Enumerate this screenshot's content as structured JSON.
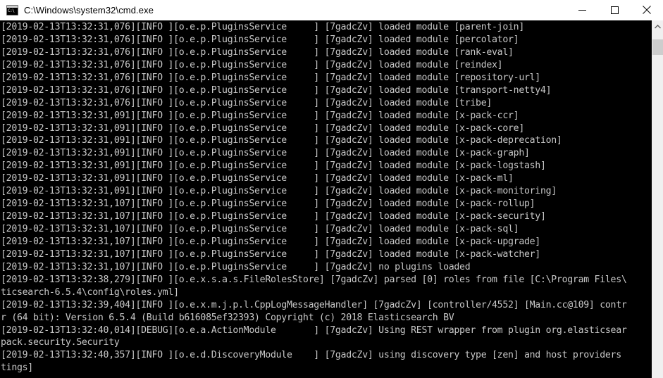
{
  "window": {
    "title": "C:\\Windows\\system32\\cmd.exe",
    "icon": "cmd-console-icon",
    "icon_text": "C:\\",
    "controls": {
      "minimize": "minimize-button",
      "maximize": "maximize-button",
      "close": "close-button"
    },
    "colors": {
      "titlebar_bg": "#ffffff",
      "title_fg": "#000000",
      "console_bg": "#000000",
      "console_fg": "#c8c8c8",
      "scrollbar_track": "#f0f0f0",
      "scrollbar_thumb": "#cdcdcd"
    }
  },
  "scrollbar": {
    "up_arrow": "scroll-up-arrow-icon",
    "thumb_position_percent": 2
  },
  "console": {
    "lines": [
      "[2019-02-13T13:32:31,076][INFO ][o.e.p.PluginsService     ] [7gadcZv] loaded module [parent-join]",
      "[2019-02-13T13:32:31,076][INFO ][o.e.p.PluginsService     ] [7gadcZv] loaded module [percolator]",
      "[2019-02-13T13:32:31,076][INFO ][o.e.p.PluginsService     ] [7gadcZv] loaded module [rank-eval]",
      "[2019-02-13T13:32:31,076][INFO ][o.e.p.PluginsService     ] [7gadcZv] loaded module [reindex]",
      "[2019-02-13T13:32:31,076][INFO ][o.e.p.PluginsService     ] [7gadcZv] loaded module [repository-url]",
      "[2019-02-13T13:32:31,076][INFO ][o.e.p.PluginsService     ] [7gadcZv] loaded module [transport-netty4]",
      "[2019-02-13T13:32:31,076][INFO ][o.e.p.PluginsService     ] [7gadcZv] loaded module [tribe]",
      "[2019-02-13T13:32:31,091][INFO ][o.e.p.PluginsService     ] [7gadcZv] loaded module [x-pack-ccr]",
      "[2019-02-13T13:32:31,091][INFO ][o.e.p.PluginsService     ] [7gadcZv] loaded module [x-pack-core]",
      "[2019-02-13T13:32:31,091][INFO ][o.e.p.PluginsService     ] [7gadcZv] loaded module [x-pack-deprecation]",
      "[2019-02-13T13:32:31,091][INFO ][o.e.p.PluginsService     ] [7gadcZv] loaded module [x-pack-graph]",
      "[2019-02-13T13:32:31,091][INFO ][o.e.p.PluginsService     ] [7gadcZv] loaded module [x-pack-logstash]",
      "[2019-02-13T13:32:31,091][INFO ][o.e.p.PluginsService     ] [7gadcZv] loaded module [x-pack-ml]",
      "[2019-02-13T13:32:31,091][INFO ][o.e.p.PluginsService     ] [7gadcZv] loaded module [x-pack-monitoring]",
      "[2019-02-13T13:32:31,107][INFO ][o.e.p.PluginsService     ] [7gadcZv] loaded module [x-pack-rollup]",
      "[2019-02-13T13:32:31,107][INFO ][o.e.p.PluginsService     ] [7gadcZv] loaded module [x-pack-security]",
      "[2019-02-13T13:32:31,107][INFO ][o.e.p.PluginsService     ] [7gadcZv] loaded module [x-pack-sql]",
      "[2019-02-13T13:32:31,107][INFO ][o.e.p.PluginsService     ] [7gadcZv] loaded module [x-pack-upgrade]",
      "[2019-02-13T13:32:31,107][INFO ][o.e.p.PluginsService     ] [7gadcZv] loaded module [x-pack-watcher]",
      "[2019-02-13T13:32:31,107][INFO ][o.e.p.PluginsService     ] [7gadcZv] no plugins loaded",
      "[2019-02-13T13:32:38,279][INFO ][o.e.x.s.a.s.FileRolesStore] [7gadcZv] parsed [0] roles from file [C:\\Program Files\\",
      "ticsearch-6.5.4\\config\\roles.yml]",
      "[2019-02-13T13:32:39,404][INFO ][o.e.x.m.j.p.l.CppLogMessageHandler] [7gadcZv] [controller/4552] [Main.cc@109] contr",
      "r (64 bit): Version 6.5.4 (Build b616085ef32393) Copyright (c) 2018 Elasticsearch BV",
      "[2019-02-13T13:32:40,014][DEBUG][o.e.a.ActionModule       ] [7gadcZv] Using REST wrapper from plugin org.elasticsear",
      "pack.security.Security",
      "[2019-02-13T13:32:40,357][INFO ][o.e.d.DiscoveryModule    ] [7gadcZv] using discovery type [zen] and host providers ",
      "tings]"
    ]
  }
}
